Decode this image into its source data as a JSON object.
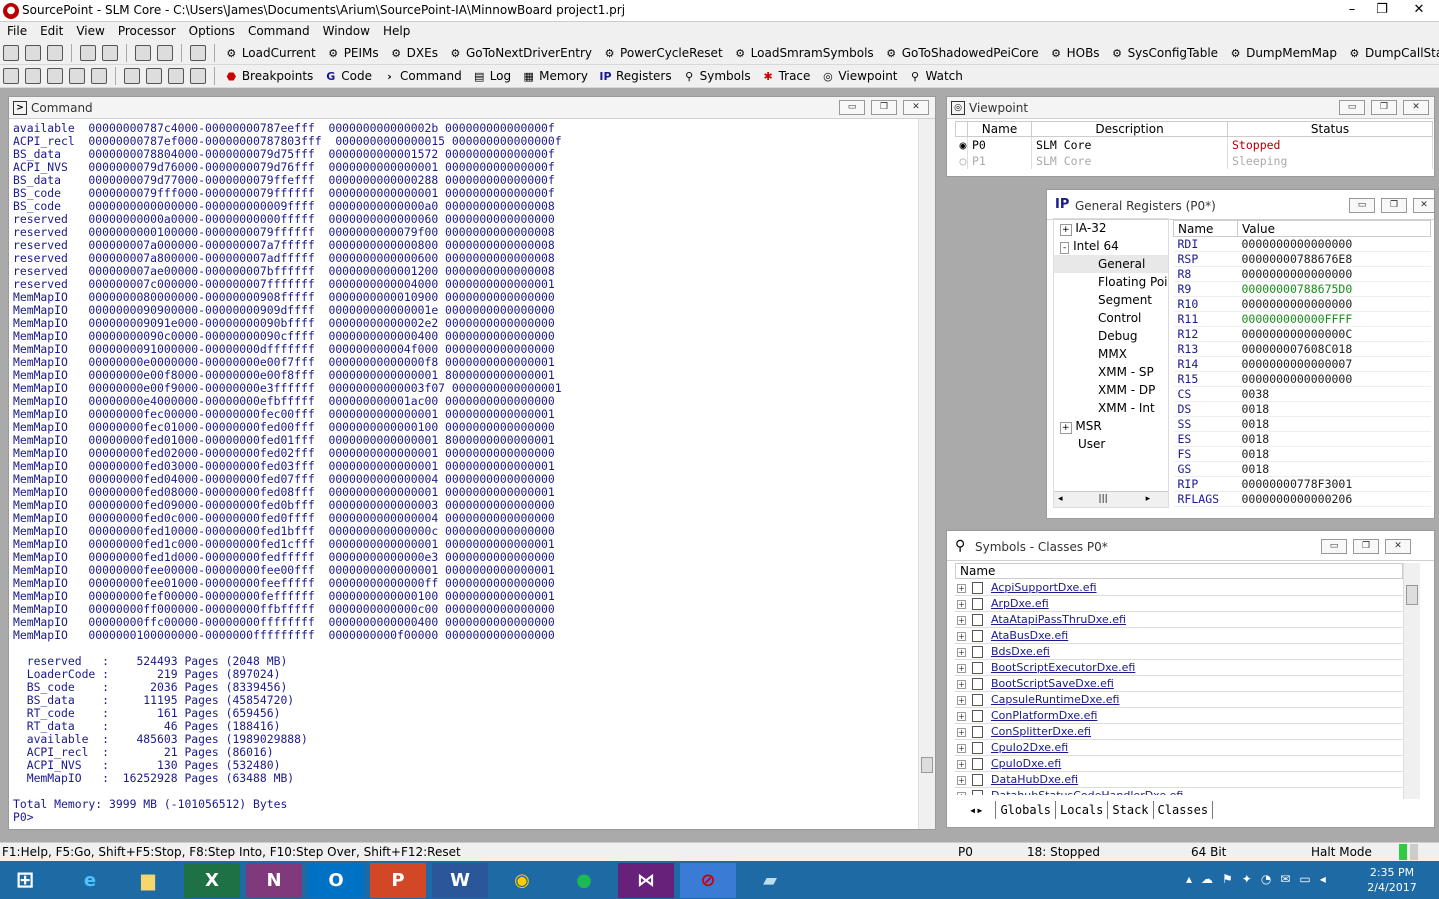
{
  "app": {
    "title": "SourcePoint - SLM Core - C:\\Users\\James\\Documents\\Arium\\SourcePoint-IA\\MinnowBoard project1.prj"
  },
  "menu": [
    "File",
    "Edit",
    "View",
    "Processor",
    "Options",
    "Command",
    "Window",
    "Help"
  ],
  "toolbar1": [
    "LoadCurrent",
    "PEIMs",
    "DXEs",
    "GoToNextDriverEntry",
    "PowerCycleReset",
    "LoadSmramSymbols",
    "GoToShadowedPeiCore",
    "HOBs",
    "SysConfigTable",
    "DumpMemMap",
    "DumpCallStack"
  ],
  "toolbar2": [
    "Breakpoints",
    "Code",
    "Command",
    "Log",
    "Memory",
    "Registers",
    "Symbols",
    "Trace",
    "Viewpoint",
    "Watch"
  ],
  "command": {
    "title": "Command",
    "lines": [
      "available  00000000787c4000-00000000787eefff  000000000000002b 000000000000000f",
      "ACPI_recl  00000000787ef000-00000000787803fff  0000000000000015 000000000000000f",
      "BS_data    0000000078804000-0000000079d75fff  0000000000001572 000000000000000f",
      "ACPI_NVS   0000000079d76000-0000000079d76fff  0000000000000001 000000000000000f",
      "BS_data    0000000079d77000-0000000079ffefff  0000000000000288 000000000000000f",
      "BS_code    0000000079fff000-0000000079ffffff  0000000000000001 000000000000000f",
      "BS_code    0000000000000000-000000000009ffff  00000000000000a0 0000000000000008",
      "reserved   00000000000a0000-00000000000fffff  0000000000000060 0000000000000000",
      "reserved   0000000000100000-0000000079ffffff  0000000000079f00 0000000000000008",
      "reserved   000000007a000000-000000007a7fffff  0000000000000800 0000000000000008",
      "reserved   000000007a800000-000000007adfffff  0000000000000600 0000000000000008",
      "reserved   000000007ae00000-000000007bffffff  0000000000001200 0000000000000008",
      "reserved   000000007c000000-000000007fffffff  0000000000004000 0000000000000001",
      "MemMapIO   0000000080000000-00000000908fffff  0000000000010900 0000000000000000",
      "MemMapIO   0000000090900000-00000000909dffff  000000000000001e 0000000000000000",
      "MemMapIO   000000009091e000-00000000090bffff  00000000000002e2 0000000000000000",
      "MemMapIO   00000000090c0000-00000000090cffff  0000000000000400 0000000000000000",
      "MemMapIO   0000000091000000-00000000dfffffff  000000000004f000 0000000000000000",
      "MemMapIO   00000000e0000000-00000000e00f7fff  00000000000000f8 0000000000000001",
      "MemMapIO   00000000e00f8000-00000000e00f8fff  0000000000000001 8000000000000001",
      "MemMapIO   00000000e00f9000-00000000e3ffffff  00000000000003f07 0000000000000001",
      "MemMapIO   00000000e4000000-00000000efbfffff  000000000001ac00 0000000000000000",
      "MemMapIO   00000000fec00000-00000000fec00fff  0000000000000001 0000000000000001",
      "MemMapIO   00000000fec01000-00000000fed00fff  0000000000000100 0000000000000000",
      "MemMapIO   00000000fed01000-00000000fed01fff  0000000000000001 8000000000000001",
      "MemMapIO   00000000fed02000-00000000fed02fff  0000000000000001 0000000000000000",
      "MemMapIO   00000000fed03000-00000000fed03fff  0000000000000001 0000000000000001",
      "MemMapIO   00000000fed04000-00000000fed07fff  0000000000000004 0000000000000000",
      "MemMapIO   00000000fed08000-00000000fed08fff  0000000000000001 0000000000000001",
      "MemMapIO   00000000fed09000-00000000fed0bfff  0000000000000003 0000000000000000",
      "MemMapIO   00000000fed0c000-00000000fed0ffff  0000000000000004 0000000000000000",
      "MemMapIO   00000000fed10000-00000000fed1bfff  000000000000000c 0000000000000000",
      "MemMapIO   00000000fed1c000-00000000fed1cfff  0000000000000001 0000000000000001",
      "MemMapIO   00000000fed1d000-00000000fedfffff  00000000000000e3 0000000000000000",
      "MemMapIO   00000000fee00000-00000000fee00fff  0000000000000001 0000000000000001",
      "MemMapIO   00000000fee01000-00000000feefffff  00000000000000ff 0000000000000000",
      "MemMapIO   00000000fef00000-00000000feffffff  0000000000000100 0000000000000001",
      "MemMapIO   00000000ff000000-00000000ffbfffff  0000000000000c00 0000000000000000",
      "MemMapIO   00000000ffc00000-00000000ffffffff  0000000000000400 0000000000000000",
      "MemMapIO   0000000100000000-0000000fffffffff  0000000000f00000 0000000000000000",
      "",
      "  reserved   :    524493 Pages (2048 MB)",
      "  LoaderCode :       219 Pages (897024)",
      "  BS_code    :      2036 Pages (8339456)",
      "  BS_data    :     11195 Pages (45854720)",
      "  RT_code    :       161 Pages (659456)",
      "  RT_data    :        46 Pages (188416)",
      "  available  :    485603 Pages (1989029888)",
      "  ACPI_recl  :        21 Pages (86016)",
      "  ACPI_NVS   :       130 Pages (532480)",
      "  MemMapIO   :  16252928 Pages (63488 MB)",
      "",
      "Total Memory: 3999 MB (-101056512) Bytes",
      "P0>"
    ]
  },
  "viewpoint": {
    "title": "Viewpoint",
    "headers": [
      "Name",
      "Description",
      "Status"
    ],
    "rows": [
      {
        "name": "P0",
        "description": "SLM Core",
        "status": "Stopped"
      },
      {
        "name": "P1",
        "description": "SLM Core",
        "status": "Sleeping"
      }
    ]
  },
  "registers": {
    "title": "General Registers (P0*)",
    "tree": [
      "IA-32",
      "Intel 64",
      "General",
      "Floating Poir",
      "Segment",
      "Control",
      "Debug",
      "MMX",
      "XMM - SP",
      "XMM - DP",
      "XMM - Int",
      "MSR",
      "User"
    ],
    "headers": [
      "Name",
      "Value"
    ],
    "rows": [
      [
        "RDI",
        "0000000000000000"
      ],
      [
        "RSP",
        "00000000788676E8"
      ],
      [
        "R8",
        "0000000000000000"
      ],
      [
        "R9",
        "00000000788675D0"
      ],
      [
        "R10",
        "0000000000000000"
      ],
      [
        "R11",
        "000000000000FFFF"
      ],
      [
        "R12",
        "000000000000000C"
      ],
      [
        "R13",
        "000000007608C018"
      ],
      [
        "R14",
        "0000000000000007"
      ],
      [
        "R15",
        "0000000000000000"
      ],
      [
        "CS",
        "0038"
      ],
      [
        "DS",
        "0018"
      ],
      [
        "SS",
        "0018"
      ],
      [
        "ES",
        "0018"
      ],
      [
        "FS",
        "0018"
      ],
      [
        "GS",
        "0018"
      ],
      [
        "RIP",
        "00000000778F3001"
      ],
      [
        "RFLAGS",
        "0000000000000206"
      ]
    ]
  },
  "symbols": {
    "title": "Symbols - Classes P0*",
    "header": "Name",
    "items": [
      "AcpiSupportDxe.efi",
      "ArpDxe.efi",
      "AtaAtapiPassThruDxe.efi",
      "AtaBusDxe.efi",
      "BdsDxe.efi",
      "BootScriptExecutorDxe.efi",
      "BootScriptSaveDxe.efi",
      "CapsuleRuntimeDxe.efi",
      "ConPlatformDxe.efi",
      "ConSplitterDxe.efi",
      "CpuIo2Dxe.efi",
      "CpuIoDxe.efi",
      "DataHubDxe.efi",
      "DatahubStatusCodeHandlerDxe.efi"
    ],
    "tabs": [
      "Globals",
      "Locals",
      "Stack",
      "Classes"
    ]
  },
  "status": {
    "help": "F1:Help, F5:Go, Shift+F5:Stop, F8:Step Into, F10:Step Over, Shift+F12:Reset",
    "proc": "P0",
    "state": "18: Stopped",
    "bits": "64 Bit",
    "mode": "Halt Mode"
  },
  "taskbar": {
    "time": "2:35 PM",
    "date": "2/4/2017"
  },
  "colors": {
    "accent": "#1a1a8c",
    "taskbar": "#1d6aa5",
    "stopped": "#b00000"
  }
}
